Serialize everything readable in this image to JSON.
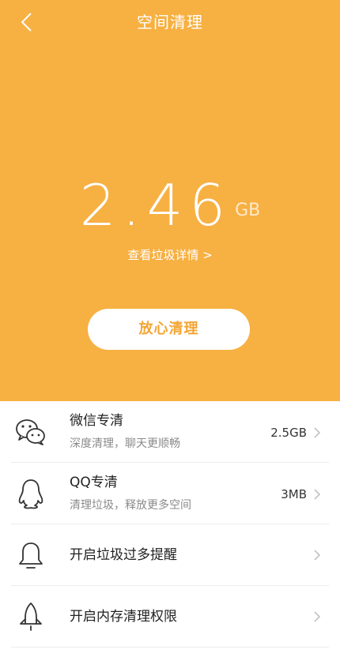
{
  "header": {
    "title": "空间清理"
  },
  "summary": {
    "size_value": "2.46",
    "size_unit": "GB",
    "detail_link": "查看垃圾详情 >",
    "clean_button": "放心清理"
  },
  "items": [
    {
      "title": "微信专清",
      "subtitle": "深度清理，聊天更顺畅",
      "value": "2.5GB",
      "icon": "wechat-icon"
    },
    {
      "title": "QQ专清",
      "subtitle": "清理垃圾，释放更多空间",
      "value": "3MB",
      "icon": "qq-penguin-icon"
    },
    {
      "title": "开启垃圾过多提醒",
      "subtitle": "",
      "value": "",
      "icon": "bell-icon"
    },
    {
      "title": "开启内存清理权限",
      "subtitle": "",
      "value": "",
      "icon": "rocket-icon"
    }
  ],
  "colors": {
    "accent": "#f7b042",
    "button_text": "#f4a534"
  }
}
